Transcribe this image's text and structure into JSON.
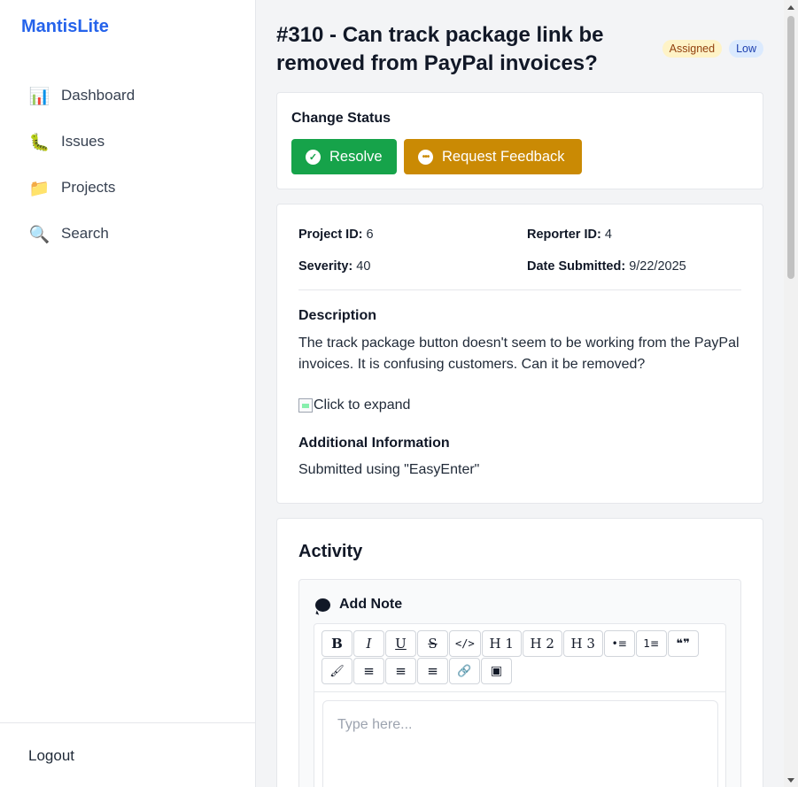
{
  "sidebar": {
    "brand": "MantisLite",
    "items": [
      {
        "label": "Dashboard",
        "icon": "📊"
      },
      {
        "label": "Issues",
        "icon": "🐛"
      },
      {
        "label": "Projects",
        "icon": "📁"
      },
      {
        "label": "Search",
        "icon": "🔍"
      }
    ],
    "logout": "Logout"
  },
  "issue": {
    "title": "#310 - Can track package link be removed from PayPal invoices?",
    "status_badge": "Assigned",
    "priority_badge": "Low"
  },
  "status": {
    "heading": "Change Status",
    "resolve_label": "Resolve",
    "feedback_label": "Request Feedback"
  },
  "details": {
    "project_id_label": "Project ID:",
    "project_id": "6",
    "reporter_id_label": "Reporter ID:",
    "reporter_id": "4",
    "severity_label": "Severity:",
    "severity": "40",
    "date_label": "Date Submitted:",
    "date": "9/22/2025",
    "description_heading": "Description",
    "description": "The track package button doesn't seem to be working from the PayPal invoices. It is confusing customers. Can it be removed?",
    "image_alt": "Click to expand",
    "additional_heading": "Additional Information",
    "additional": "Submitted using \"EasyEnter\""
  },
  "activity": {
    "heading": "Activity",
    "add_note": "Add Note",
    "placeholder": "Type here...",
    "toolbar": [
      "B",
      "I",
      "U",
      "S",
      "</>",
      "H 1",
      "H 2",
      "H 3",
      "•≡",
      "1≡",
      "❝❞",
      "🖌",
      "≡",
      "≡",
      "≡",
      "🔗",
      "▣"
    ]
  },
  "colors": {
    "brand": "#2563eb",
    "resolve": "#16a34a",
    "feedback": "#ca8a04",
    "assigned_bg": "#fef3c7",
    "low_bg": "#dbeafe"
  }
}
